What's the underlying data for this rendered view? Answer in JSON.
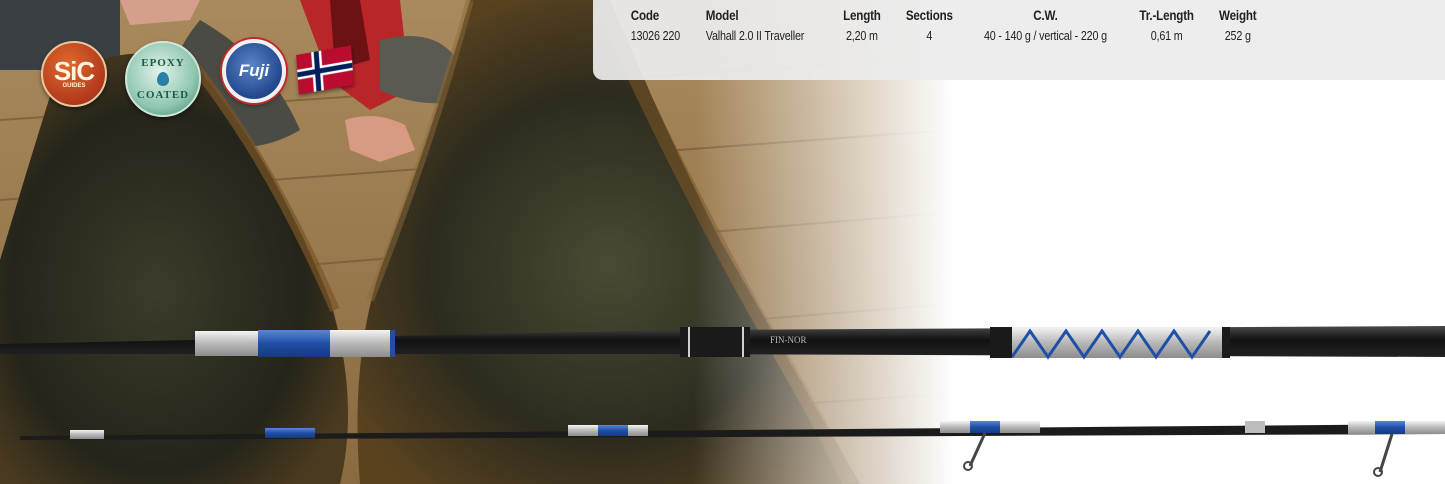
{
  "table": {
    "headers": {
      "code": "Code",
      "model": "Model",
      "length": "Length",
      "sections": "Sections",
      "cw": "C.W.",
      "tr_length": "Tr.-Length",
      "weight": "Weight"
    },
    "rows": [
      {
        "code": "13026 220",
        "model": "Valhall 2.0 II Traveller",
        "length": "2,20 m",
        "sections": "4",
        "cw": "40 - 140 g / vertical - 220 g",
        "tr_length": "0,61 m",
        "weight": "252 g"
      }
    ]
  },
  "badges": {
    "sic_big": "SiC",
    "sic_small": "GUIDES",
    "epoxy_top": "EPOXY",
    "epoxy_bottom": "COATED",
    "fuji": "Fuji",
    "flag_icon": "norway-flag-icon"
  },
  "rod_brand_text": "FIN-NOR",
  "colors": {
    "panel_bg": "#ececec",
    "rod_blue": "#1f4fa6",
    "text": "#222222"
  }
}
